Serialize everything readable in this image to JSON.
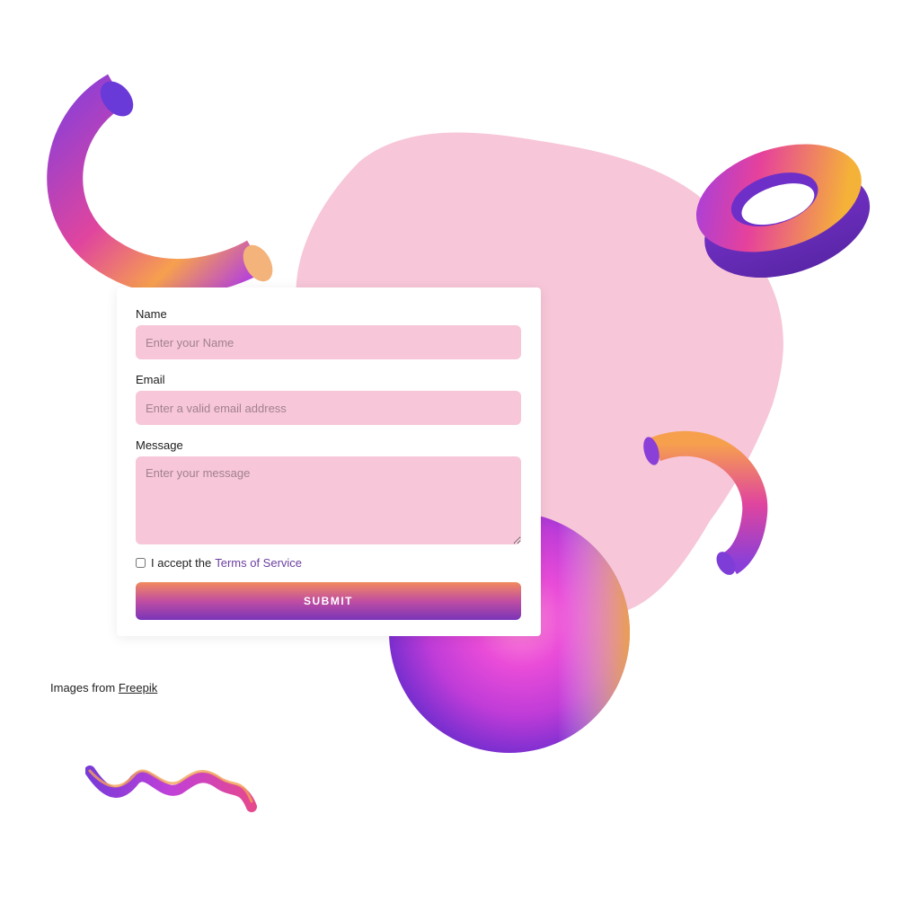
{
  "form": {
    "name_label": "Name",
    "name_placeholder": "Enter your Name",
    "email_label": "Email",
    "email_placeholder": "Enter a valid email address",
    "message_label": "Message",
    "message_placeholder": "Enter your message",
    "terms_prefix": "I accept the",
    "terms_link": "Terms of Service",
    "terms_checked": false,
    "submit_label": "SUBMIT"
  },
  "credit": {
    "prefix": "Images from",
    "link": "Freepik"
  },
  "colors": {
    "blob": "#f7c6d8",
    "input_bg": "#f7c6d8",
    "link": "#6b3fa0",
    "submit_top": "#f28a5d",
    "submit_bottom": "#7a34b8"
  },
  "decorations": [
    "curved-tube-icon",
    "torus-ring-icon",
    "gradient-sphere-icon",
    "arc-tube-icon",
    "wave-ribbon-icon"
  ]
}
